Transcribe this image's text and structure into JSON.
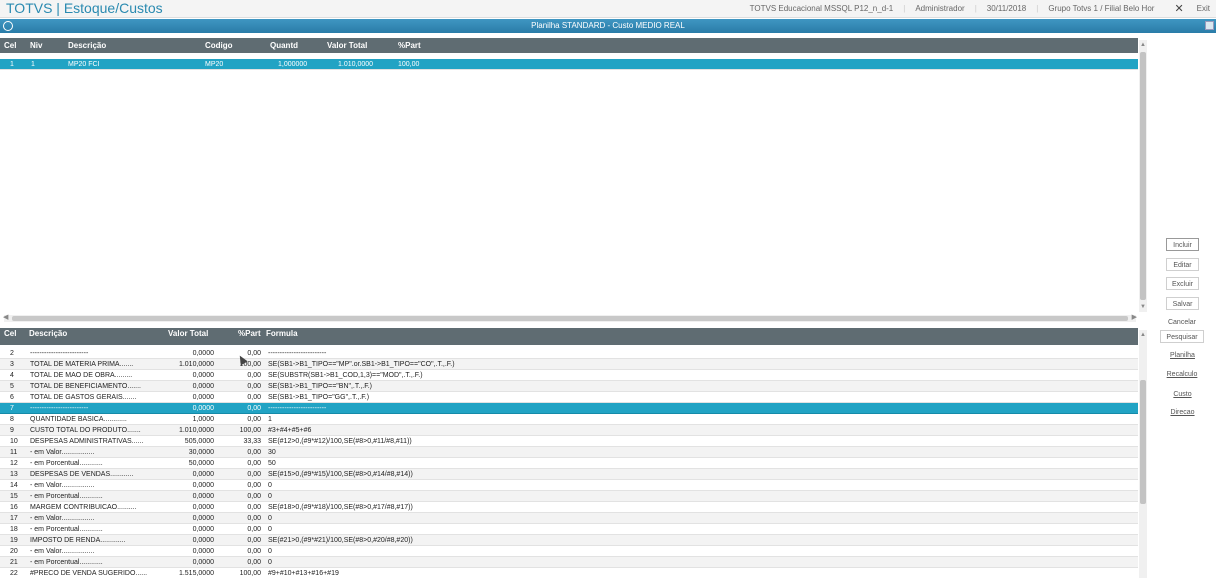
{
  "app": {
    "title": "TOTVS | Estoque/Custos",
    "environment": "TOTVS Educacional MSSQL P12_n_d-1",
    "user": "Administrador",
    "date": "30/11/2018",
    "branch": "Grupo Totvs 1 / Filial Belo Hor",
    "exit_label": "Exit"
  },
  "window": {
    "title": "Planilha STANDARD - Custo MEDIO REAL"
  },
  "top_grid": {
    "columns": [
      "Cel",
      "Niv",
      "Descrição",
      "Codigo",
      "Quantd",
      "Valor Total",
      "%Part"
    ],
    "rows": [
      [
        "1",
        "1",
        "MP20 FCI",
        "MP20",
        "1,000000",
        "1.010,0000",
        "100,00"
      ]
    ]
  },
  "bottom_grid": {
    "columns": [
      "Cel",
      "Descrição",
      "Valor Total",
      "%Part",
      "Formula"
    ],
    "rows": [
      [
        "2",
        "-------------------------",
        "0,0000",
        "0,00",
        "-------------------------"
      ],
      [
        "3",
        "TOTAL DE MATERIA PRIMA.......",
        "1.010,0000",
        "100,00",
        "SE(SB1->B1_TIPO==\"MP\".or.SB1->B1_TIPO==\"CO\",.T.,.F.)"
      ],
      [
        "4",
        "TOTAL DE MAO DE OBRA.........",
        "0,0000",
        "0,00",
        "SE(SUBSTR(SB1->B1_COD,1,3)==\"MOD\",.T.,.F.)"
      ],
      [
        "5",
        "TOTAL DE BENEFICIAMENTO.......",
        "0,0000",
        "0,00",
        "SE(SB1->B1_TIPO==\"BN\",.T.,.F.)"
      ],
      [
        "6",
        "TOTAL DE GASTOS GERAIS.......",
        "0,0000",
        "0,00",
        "SE(SB1->B1_TIPO=\"GG\",.T.,.F.)"
      ],
      [
        "7",
        "-------------------------",
        "0,0000",
        "0,00",
        "-------------------------"
      ],
      [
        "8",
        "QUANTIDADE BASICA............",
        "1,0000",
        "0,00",
        "1"
      ],
      [
        "9",
        "CUSTO TOTAL DO PRODUTO.......",
        "1.010,0000",
        "100,00",
        "#3+#4+#5+#6"
      ],
      [
        "10",
        "DESPESAS ADMINISTRATIVAS......",
        "505,0000",
        "33,33",
        "SE(#12>0,(#9*#12)/100,SE(#8>0,#11/#8,#11))"
      ],
      [
        "11",
        "  - em Valor.................",
        "30,0000",
        "0,00",
        "30"
      ],
      [
        "12",
        "  - em Porcentual............",
        "50,0000",
        "0,00",
        "50"
      ],
      [
        "13",
        "DESPESAS DE VENDAS............",
        "0,0000",
        "0,00",
        "SE(#15>0,(#9*#15)/100,SE(#8>0,#14/#8,#14))"
      ],
      [
        "14",
        "  - em Valor.................",
        "0,0000",
        "0,00",
        "0"
      ],
      [
        "15",
        "  - em Porcentual............",
        "0,0000",
        "0,00",
        "0"
      ],
      [
        "16",
        "MARGEM CONTRIBUICAO..........",
        "0,0000",
        "0,00",
        "SE(#18>0,(#9*#18)/100,SE(#8>0,#17/#8,#17))"
      ],
      [
        "17",
        "  - em Valor.................",
        "0,0000",
        "0,00",
        "0"
      ],
      [
        "18",
        "  - em Porcentual............",
        "0,0000",
        "0,00",
        "0"
      ],
      [
        "19",
        "IMPOSTO DE RENDA.............",
        "0,0000",
        "0,00",
        "SE(#21>0,(#9*#21)/100,SE(#8>0,#20/#8,#20))"
      ],
      [
        "20",
        "  - em Valor.................",
        "0,0000",
        "0,00",
        "0"
      ],
      [
        "21",
        "  - em Porcentual............",
        "0,0000",
        "0,00",
        "0"
      ],
      [
        "22",
        "#PRECO DE VENDA SUGERIDO......",
        "1.515,0000",
        "100,00",
        "#9+#10+#13+#16+#19"
      ]
    ]
  },
  "buttons_top": [
    "Incluir",
    "Editar",
    "Excluir",
    "Salvar",
    "Cancelar"
  ],
  "buttons_bottom": [
    "Pesquisar",
    "Planilha",
    "Recalculo",
    "Custo",
    "Direcao"
  ],
  "colors": {
    "header_bg": "#5f6c72",
    "selection": "#21a3c4",
    "brand": "#2a8ab0"
  }
}
